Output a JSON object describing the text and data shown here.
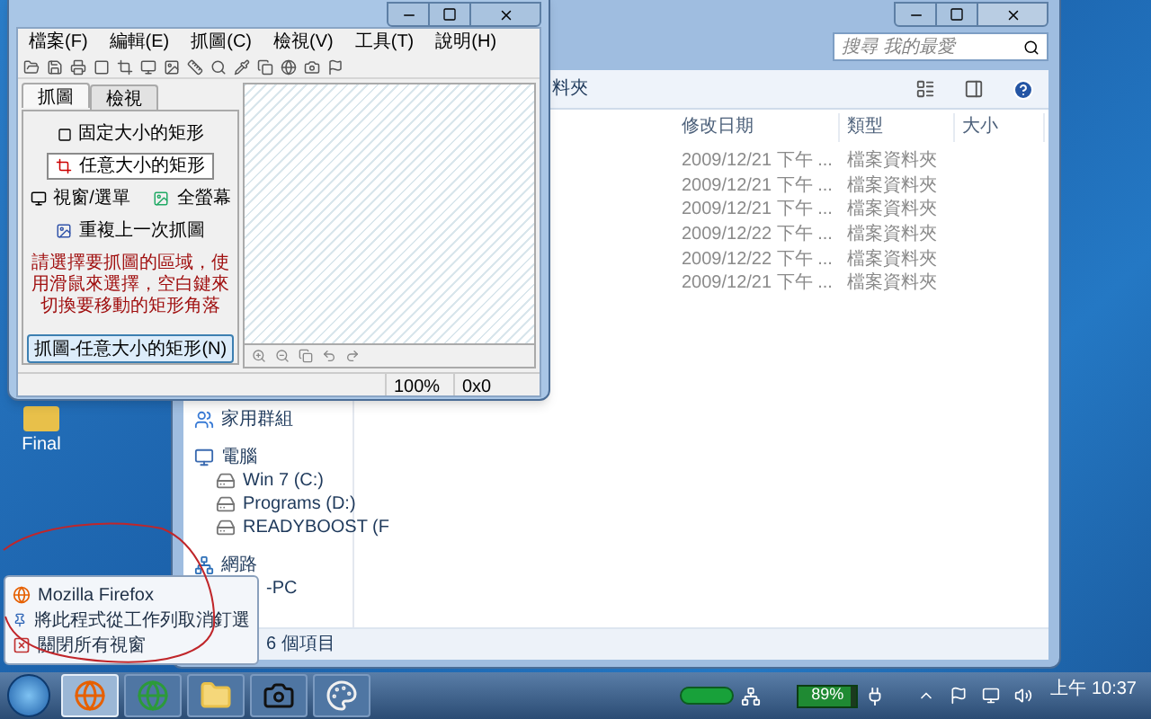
{
  "desktop": {
    "icons": [
      {
        "label": "Final"
      }
    ]
  },
  "explorer": {
    "search": {
      "placeholder": "搜尋 我的最愛"
    },
    "toolbar_text": "料夾",
    "columns": [
      "修改日期",
      "類型",
      "大小"
    ],
    "rows": [
      {
        "modified": "2009/12/21 下午 ...",
        "type": "檔案資料夾"
      },
      {
        "modified": "2009/12/21 下午 ...",
        "type": "檔案資料夾"
      },
      {
        "modified": "2009/12/21 下午 ...",
        "type": "檔案資料夾"
      },
      {
        "modified": "2009/12/22 下午 ...",
        "type": "檔案資料夾"
      },
      {
        "modified": "2009/12/22 下午 ...",
        "type": "檔案資料夾"
      },
      {
        "modified": "2009/12/21 下午 ...",
        "type": "檔案資料夾"
      }
    ],
    "nav": [
      {
        "kind": "homegroup",
        "label": "家用群組"
      },
      {
        "kind": "computer",
        "label": "電腦",
        "children": [
          {
            "kind": "drive",
            "label": "Win 7 (C:)"
          },
          {
            "kind": "drive",
            "label": "Programs (D:)"
          },
          {
            "kind": "drive",
            "label": "READYBOOST (F"
          }
        ]
      },
      {
        "kind": "network",
        "label": "網路",
        "children": [
          {
            "kind": "pc",
            "label": "-PC"
          }
        ]
      }
    ],
    "status": "6 個項目"
  },
  "capture_window": {
    "menu": [
      "檔案(F)",
      "編輯(E)",
      "抓圖(C)",
      "檢視(V)",
      "工具(T)",
      "說明(H)"
    ],
    "tabs": [
      {
        "label": "抓圖",
        "selected": true
      },
      {
        "label": "檢視",
        "selected": false
      }
    ],
    "capture_modes": [
      {
        "label": "固定大小的矩形",
        "selected": false
      },
      {
        "label": "任意大小的矩形",
        "selected": true
      },
      {
        "label": "視窗/選單",
        "selected": false
      },
      {
        "label": "全螢幕",
        "selected": false
      },
      {
        "label": "重複上一次抓圖",
        "selected": false
      }
    ],
    "hint": "請選擇要抓圖的區域，使用滑鼠來選擇，空白鍵來切換要移動的矩形角落",
    "capture_button": "抓圖-任意大小的矩形(N)",
    "status": {
      "zoom": "100%",
      "size": "0x0"
    }
  },
  "jump_list": {
    "items": [
      {
        "kind": "app",
        "label": "Mozilla Firefox"
      },
      {
        "kind": "unpin",
        "label": "將此程式從工作列取消釘選"
      },
      {
        "kind": "close",
        "label": "關閉所有視窗"
      }
    ]
  },
  "taskbar": {
    "buttons": [
      {
        "kind": "browser",
        "selected": true
      },
      {
        "kind": "globe",
        "selected": false
      },
      {
        "kind": "folder",
        "selected": false
      },
      {
        "kind": "camera",
        "selected": false
      },
      {
        "kind": "palette",
        "selected": false
      }
    ],
    "battery": {
      "reading": "89%",
      "level": 0.89
    },
    "clock": "上午 10:37"
  }
}
